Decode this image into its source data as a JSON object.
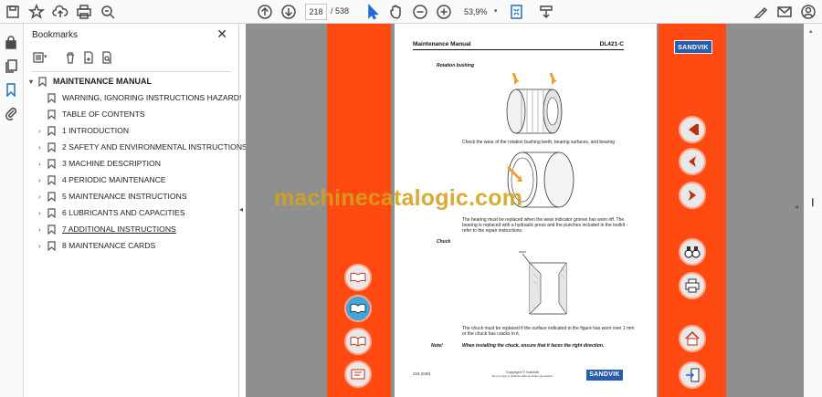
{
  "toolbar": {
    "page_current": "218",
    "page_total": "/ 538",
    "zoom": "53,9%"
  },
  "bookmarks_panel": {
    "title": "Bookmarks",
    "close": "✕",
    "items": [
      {
        "label": "MAINTENANCE MANUAL"
      },
      {
        "label": "WARNING, IGNORING INSTRUCTIONS HAZARD!"
      },
      {
        "label": "TABLE OF CONTENTS"
      },
      {
        "label": "1 INTRODUCTION"
      },
      {
        "label": "2 SAFETY AND ENVIRONMENTAL INSTRUCTIONS"
      },
      {
        "label": "3 MACHINE DESCRIPTION"
      },
      {
        "label": "4 PERIODIC MAINTENANCE"
      },
      {
        "label": "5 MAINTENANCE INSTRUCTIONS"
      },
      {
        "label": "6 LUBRICANTS AND CAPACITIES"
      },
      {
        "label": "7 ADDITIONAL INSTRUCTIONS"
      },
      {
        "label": "8 MAINTENANCE CARDS"
      }
    ]
  },
  "document": {
    "header_left": "Maintenance Manual",
    "header_right": "DL421-C",
    "logo": "SANDVIK",
    "section_rotation": "Rotation bushing",
    "text_check": "Check the wear of the rotation bushing teeth, bearing surfaces, and bearing",
    "text_bearing": "The bearing must be replaced when the wear indicator groove has worn off. The bearing is replaced with a hydraulic press and the punches included in the toolkit - refer to the repair instructions.",
    "section_chuck": "Chuck",
    "text_chuck": "The chuck must be replaced if the surface indicated in the figure has worn over 1 mm or the chuck has cracks in it.",
    "note_label": "Note!",
    "note_text": "When installing the chuck, ensure that it faces the right direction.",
    "footer_page": "218 (538)",
    "footer_copyright": "Copyright © Sandvik",
    "footer_small": "Do not copy or disclose without written permission"
  },
  "watermark": "machinecatalogic.com",
  "colors": {
    "orange": "#ff4b12",
    "sandvik_blue": "#2a5dad",
    "watermark": "#d4a21c"
  }
}
